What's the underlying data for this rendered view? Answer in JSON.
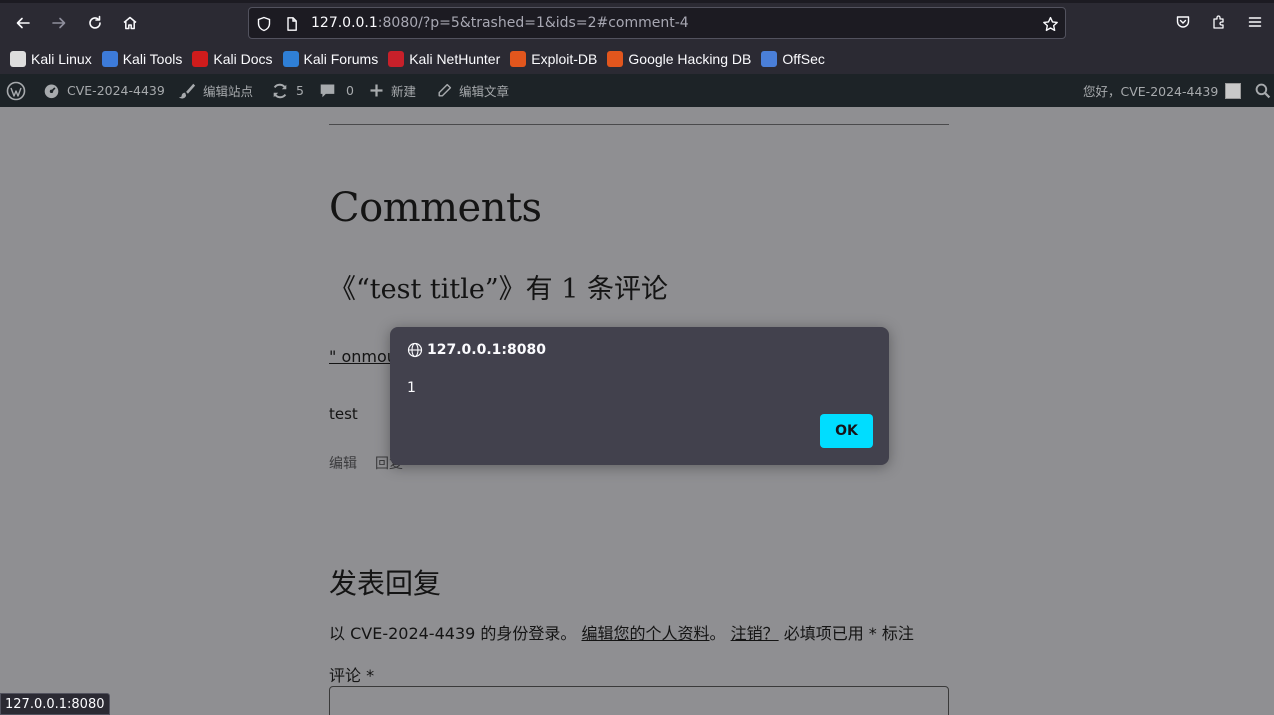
{
  "browser": {
    "url_host": "127.0.0.1",
    "url_rest": ":8080/?p=5&trashed=1&ids=2#comment-4",
    "bookmarks": [
      {
        "label": "Kali Linux",
        "color": "#dddddd"
      },
      {
        "label": "Kali Tools",
        "color": "#3d7bd9"
      },
      {
        "label": "Kali Docs",
        "color": "#d01c1c"
      },
      {
        "label": "Kali Forums",
        "color": "#2f7fd6"
      },
      {
        "label": "Kali NetHunter",
        "color": "#c8202a"
      },
      {
        "label": "Exploit-DB",
        "color": "#e2561d"
      },
      {
        "label": "Google Hacking DB",
        "color": "#e2561d"
      },
      {
        "label": "OffSec",
        "color": "#4a7fd8"
      }
    ],
    "status_url": "127.0.0.1:8080"
  },
  "adminbar": {
    "site_name": "CVE-2024-4439",
    "customize": "编辑站点",
    "updates_count": "5",
    "comments_count": "0",
    "new": "新建",
    "edit_post": "编辑文章",
    "greeting": "您好，CVE-2024-4439"
  },
  "page": {
    "comments_title": "Comments",
    "comments_sub": "《“test title”》有 1 条评论",
    "author_link": "\" onmou",
    "comment_text": "test",
    "edit_link": "编辑",
    "reply_link": "回复",
    "reply_title": "发表回复",
    "logged_in_prefix": "以 CVE-2024-4439 的身份登录。",
    "edit_profile": "编辑您的个人资料",
    "period": "。",
    "logout": "注销？",
    "required_note": "必填项已用 * 标注",
    "comment_label": "评论 *"
  },
  "dialog": {
    "origin": "127.0.0.1:8080",
    "message": "1",
    "ok_label": "OK"
  },
  "colors": {
    "accent": "#00ddff",
    "adminbar_bg": "#1d2327",
    "chrome_bg": "#2b2a33"
  }
}
